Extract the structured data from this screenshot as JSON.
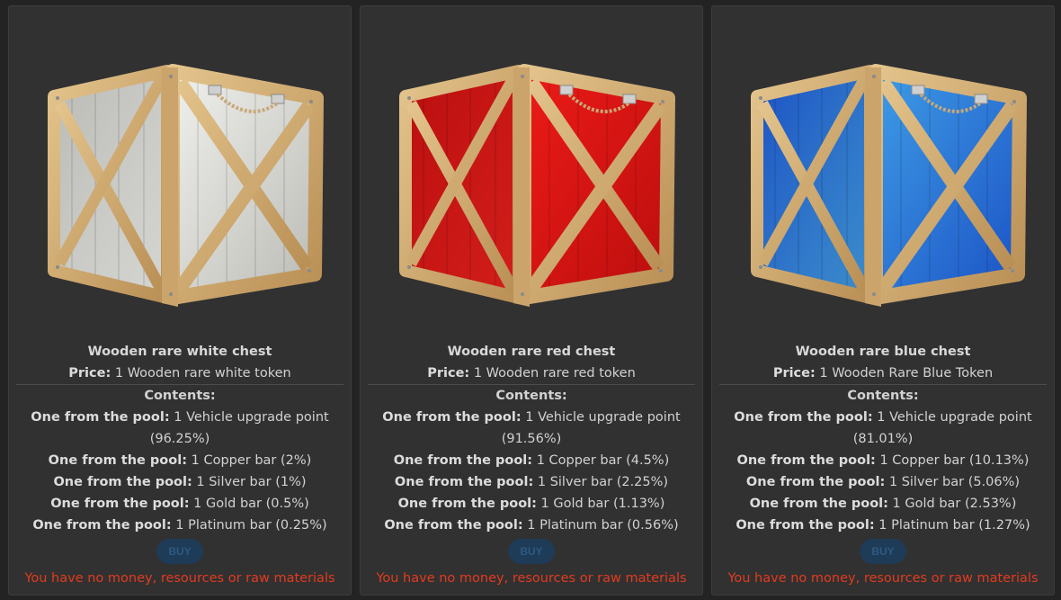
{
  "cards": [
    {
      "title": "Wooden rare white chest",
      "price_label": "Price:",
      "price_value": "1 Wooden rare white token",
      "contents_label": "Contents:",
      "items": [
        {
          "label": "One from the pool:",
          "text": "1 Vehicle upgrade point (96.25%)"
        },
        {
          "label": "One from the pool:",
          "text": "1 Copper bar (2%)"
        },
        {
          "label": "One from the pool:",
          "text": "1 Silver bar (1%)"
        },
        {
          "label": "One from the pool:",
          "text": "1 Gold bar (0.5%)"
        },
        {
          "label": "One from the pool:",
          "text": "1 Platinum bar (0.25%)"
        }
      ],
      "buy_label": "BUY",
      "error": "You have no money, resources or raw materials",
      "color_dark": "#b9b9b4",
      "color_light": "#f2f2ee"
    },
    {
      "title": "Wooden rare red chest",
      "price_label": "Price:",
      "price_value": "1 Wooden rare red token",
      "contents_label": "Contents:",
      "items": [
        {
          "label": "One from the pool:",
          "text": "1 Vehicle upgrade point (91.56%)"
        },
        {
          "label": "One from the pool:",
          "text": "1 Copper bar (4.5%)"
        },
        {
          "label": "One from the pool:",
          "text": "1 Silver bar (2.25%)"
        },
        {
          "label": "One from the pool:",
          "text": "1 Gold bar (1.13%)"
        },
        {
          "label": "One from the pool:",
          "text": "1 Platinum bar (0.56%)"
        }
      ],
      "buy_label": "BUY",
      "error": "You have no money, resources or raw materials",
      "color_dark": "#b80e0e",
      "color_light": "#ee1b17"
    },
    {
      "title": "Wooden rare blue chest",
      "price_label": "Price:",
      "price_value": "1 Wooden Rare Blue Token",
      "contents_label": "Contents:",
      "items": [
        {
          "label": "One from the pool:",
          "text": "1 Vehicle upgrade point (81.01%)"
        },
        {
          "label": "One from the pool:",
          "text": "1 Copper bar (10.13%)"
        },
        {
          "label": "One from the pool:",
          "text": "1 Silver bar (5.06%)"
        },
        {
          "label": "One from the pool:",
          "text": "1 Gold bar (2.53%)"
        },
        {
          "label": "One from the pool:",
          "text": "1 Platinum bar (1.27%)"
        }
      ],
      "buy_label": "BUY",
      "error": "You have no money, resources or raw materials",
      "color_dark": "#1a4fc4",
      "color_light": "#3f9ee6"
    }
  ],
  "colors": {
    "background": "#232323",
    "card": "#313131",
    "wood": "#d8b47c",
    "buy_bg": "#1e3b57",
    "error": "#e23b1e"
  }
}
